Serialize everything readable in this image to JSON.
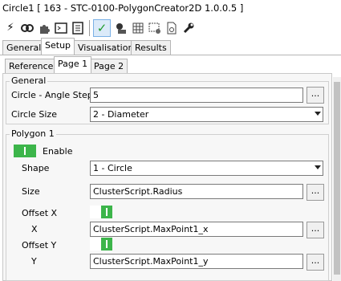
{
  "window": {
    "title": "Circle1 [ 163 - STC-0100-PolygonCreator2D 1.0.0.5 ]"
  },
  "toolbar": {
    "icons": [
      "lightning-icon",
      "link-icon",
      "puzzle-icon",
      "terminal-icon",
      "document-icon",
      "check-icon",
      "camera-settings-icon",
      "grid-icon",
      "image-settings-icon",
      "file-settings-icon",
      "wrench-icon"
    ]
  },
  "tabs": [
    "General",
    "Setup",
    "Visualisation",
    "Results"
  ],
  "subtabs": [
    "Reference",
    "Page 1",
    "Page 2"
  ],
  "general": {
    "title": "General",
    "angle_step_label": "Circle - Angle Step",
    "angle_step_value": "5",
    "circle_size_label": "Circle Size",
    "circle_size_value": "2 - Diameter"
  },
  "polygon": {
    "title": "Polygon 1",
    "enable_label": "Enable",
    "shape_label": "Shape",
    "shape_value": "1 - Circle",
    "size_label": "Size",
    "size_value": "ClusterScript.Radius",
    "offset_x_label": "Offset X",
    "x_label": "X",
    "x_value": "ClusterScript.MaxPoint1_x",
    "offset_y_label": "Offset Y",
    "y_label": "Y",
    "y_value": "ClusterScript.MaxPoint1_y"
  },
  "ellipsis": "..."
}
